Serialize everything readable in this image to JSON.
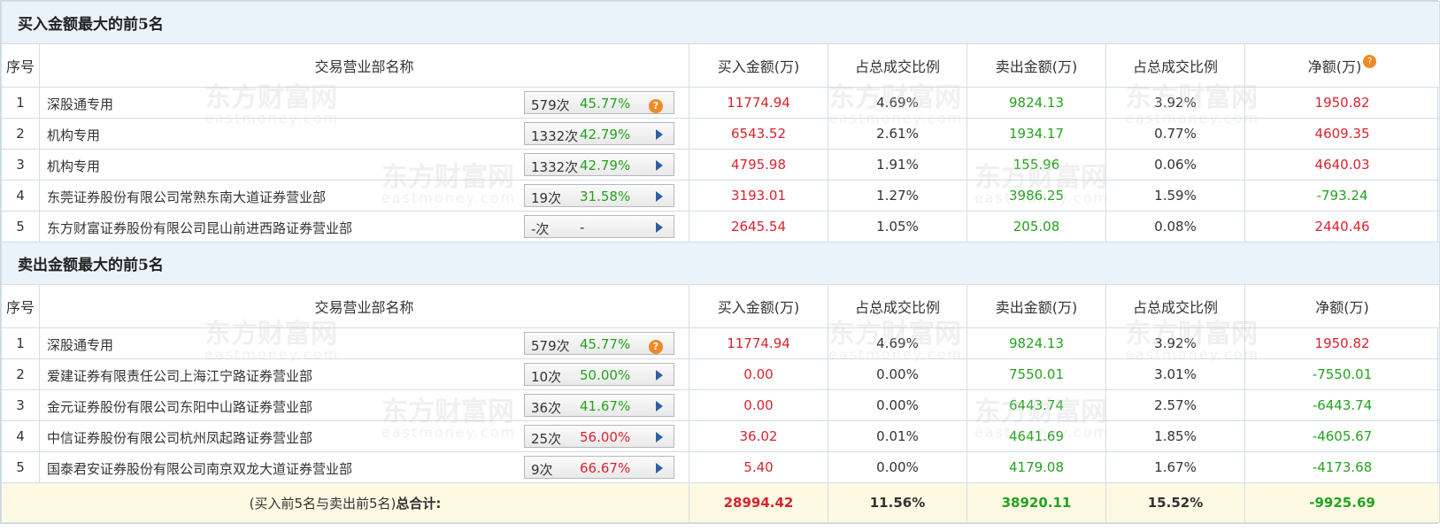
{
  "buy_section": {
    "title": "买入金额最大的前5名",
    "headers": [
      "序号",
      "交易营业部名称",
      "买入金额(万)",
      "占总成交比例",
      "卖出金额(万)",
      "占总成交比例",
      "净额(万)"
    ],
    "rows": [
      {
        "idx": "1",
        "name": "深股通专用",
        "count": "579次",
        "pct": "45.77%",
        "pct_color": "green",
        "icon": "help-icon",
        "buy": "11774.94",
        "buy_ratio": "4.69%",
        "sell": "9824.13",
        "sell_ratio": "3.92%",
        "net": "1950.82",
        "net_color": "red"
      },
      {
        "idx": "2",
        "name": "机构专用",
        "count": "1332次",
        "pct": "42.79%",
        "pct_color": "green",
        "icon": "arrow-right-icon",
        "buy": "6543.52",
        "buy_ratio": "2.61%",
        "sell": "1934.17",
        "sell_ratio": "0.77%",
        "net": "4609.35",
        "net_color": "red"
      },
      {
        "idx": "3",
        "name": "机构专用",
        "count": "1332次",
        "pct": "42.79%",
        "pct_color": "green",
        "icon": "arrow-right-icon",
        "buy": "4795.98",
        "buy_ratio": "1.91%",
        "sell": "155.96",
        "sell_ratio": "0.06%",
        "net": "4640.03",
        "net_color": "red"
      },
      {
        "idx": "4",
        "name": "东莞证券股份有限公司常熟东南大道证券营业部",
        "count": "19次",
        "pct": "31.58%",
        "pct_color": "green",
        "icon": "arrow-right-icon",
        "buy": "3193.01",
        "buy_ratio": "1.27%",
        "sell": "3986.25",
        "sell_ratio": "1.59%",
        "net": "-793.24",
        "net_color": "green"
      },
      {
        "idx": "5",
        "name": "东方财富证券股份有限公司昆山前进西路证券营业部",
        "count": "-次",
        "pct": "-",
        "pct_color": "dark",
        "icon": "arrow-right-icon",
        "buy": "2645.54",
        "buy_ratio": "1.05%",
        "sell": "205.08",
        "sell_ratio": "0.08%",
        "net": "2440.46",
        "net_color": "red"
      }
    ]
  },
  "sell_section": {
    "title": "卖出金额最大的前5名",
    "headers": [
      "序号",
      "交易营业部名称",
      "买入金额(万)",
      "占总成交比例",
      "卖出金额(万)",
      "占总成交比例",
      "净额(万)"
    ],
    "rows": [
      {
        "idx": "1",
        "name": "深股通专用",
        "count": "579次",
        "pct": "45.77%",
        "pct_color": "green",
        "icon": "help-icon",
        "buy": "11774.94",
        "buy_ratio": "4.69%",
        "sell": "9824.13",
        "sell_ratio": "3.92%",
        "net": "1950.82",
        "net_color": "red"
      },
      {
        "idx": "2",
        "name": "爱建证券有限责任公司上海江宁路证券营业部",
        "count": "10次",
        "pct": "50.00%",
        "pct_color": "green",
        "icon": "arrow-right-icon",
        "buy": "0.00",
        "buy_ratio": "0.00%",
        "sell": "7550.01",
        "sell_ratio": "3.01%",
        "net": "-7550.01",
        "net_color": "green"
      },
      {
        "idx": "3",
        "name": "金元证券股份有限公司东阳中山路证券营业部",
        "count": "36次",
        "pct": "41.67%",
        "pct_color": "green",
        "icon": "arrow-right-icon",
        "buy": "0.00",
        "buy_ratio": "0.00%",
        "sell": "6443.74",
        "sell_ratio": "2.57%",
        "net": "-6443.74",
        "net_color": "green"
      },
      {
        "idx": "4",
        "name": "中信证券股份有限公司杭州凤起路证券营业部",
        "count": "25次",
        "pct": "56.00%",
        "pct_color": "red",
        "icon": "arrow-right-icon",
        "buy": "36.02",
        "buy_ratio": "0.01%",
        "sell": "4641.69",
        "sell_ratio": "1.85%",
        "net": "-4605.67",
        "net_color": "green"
      },
      {
        "idx": "5",
        "name": "国泰君安证券股份有限公司南京双龙大道证券营业部",
        "count": "9次",
        "pct": "66.67%",
        "pct_color": "red",
        "icon": "arrow-right-icon",
        "buy": "5.40",
        "buy_ratio": "0.00%",
        "sell": "4179.08",
        "sell_ratio": "1.67%",
        "net": "-4173.68",
        "net_color": "green"
      }
    ]
  },
  "total": {
    "label_prefix": "(买入前5名与卖出前5名)",
    "label_bold": "总合计:",
    "buy": "28994.42",
    "buy_ratio": "11.56%",
    "sell": "38920.11",
    "sell_ratio": "15.52%",
    "net": "-9925.69"
  },
  "watermark": {
    "cn": "东方财富网",
    "en": "eastmoney.com"
  },
  "colors": {
    "red": "#d9232e",
    "green": "#24a31d",
    "header_bg": "#eaf3fa",
    "total_bg": "#fdf9e3"
  }
}
